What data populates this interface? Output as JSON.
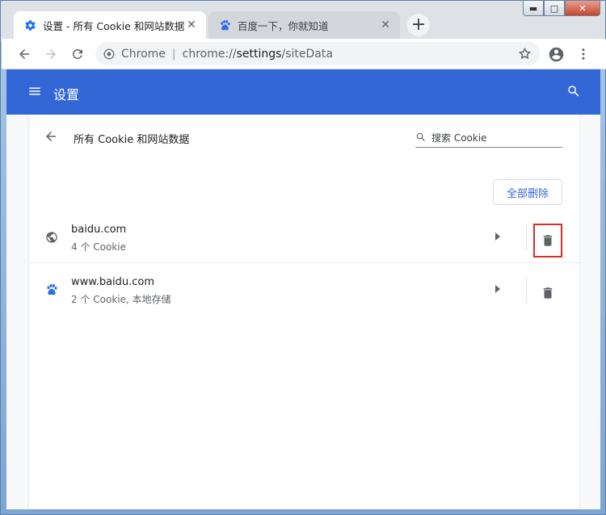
{
  "window": {
    "controls": {
      "minimize": "▬",
      "maximize": "□",
      "close": "✕"
    }
  },
  "tabs": [
    {
      "title": "设置 - 所有 Cookie 和网站数据",
      "icon": "gear-icon",
      "active": true
    },
    {
      "title": "百度一下，你就知道",
      "icon": "baidu-paw-icon",
      "active": false
    }
  ],
  "new_tab_label": "+",
  "toolbar": {
    "site_chip": "Chrome",
    "url_scheme": "chrome://",
    "url_host": "settings",
    "url_path": "/siteData"
  },
  "settings_header": {
    "title": "设置"
  },
  "site_data": {
    "title": "所有 Cookie 和网站数据",
    "search_placeholder": "搜索 Cookie",
    "remove_all_label": "全部删除",
    "sites": [
      {
        "name": "baidu.com",
        "desc": "4 个 Cookie",
        "icon": "globe-icon"
      },
      {
        "name": "www.baidu.com",
        "desc": "2 个 Cookie, 本地存储",
        "icon": "baidu-paw-icon"
      }
    ]
  },
  "colors": {
    "accent": "#3367d6",
    "highlight_border": "#d93025"
  }
}
